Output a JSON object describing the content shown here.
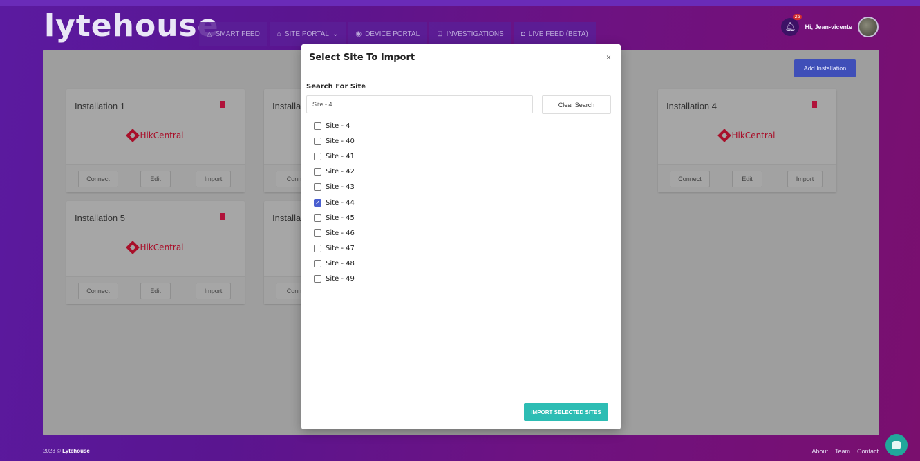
{
  "app": {
    "logo_text": "lytehouse"
  },
  "nav": [
    {
      "label": "SMART FEED",
      "icon": "bell-outline-icon"
    },
    {
      "label": "SITE PORTAL",
      "icon": "home-icon"
    },
    {
      "label": "DEVICE PORTAL",
      "icon": "device-icon"
    },
    {
      "label": "INVESTIGATIONS",
      "icon": "investigation-icon"
    },
    {
      "label": "LIVE FEED (BETA)",
      "icon": "camera-icon"
    }
  ],
  "user": {
    "notification_count": "26",
    "greeting": "Hi, Jean-vicente"
  },
  "main": {
    "add_button_label": "Add Installation",
    "cards": [
      {
        "title": "Installation 1",
        "brand": "HikCentral"
      },
      {
        "title": "Installa",
        "brand": ""
      },
      {
        "title": "Installation 4",
        "brand": "HikCentral"
      },
      {
        "title": "Installation 5",
        "brand": "HikCentral"
      },
      {
        "title": "Installa",
        "brand": ""
      }
    ],
    "card_actions": {
      "connect": "Connect",
      "edit": "Edit",
      "import": "Import",
      "connect_partial": "Conne"
    }
  },
  "modal": {
    "title": "Select Site To Import",
    "close_glyph": "×",
    "search_label": "Search For Site",
    "search_value": "Site - 4",
    "clear_label": "Clear Search",
    "sites": [
      {
        "label": "Site - 4",
        "checked": false
      },
      {
        "label": "Site - 40",
        "checked": false
      },
      {
        "label": "Site - 41",
        "checked": false
      },
      {
        "label": "Site - 42",
        "checked": false
      },
      {
        "label": "Site - 43",
        "checked": false
      },
      {
        "label": "Site - 44",
        "checked": true
      },
      {
        "label": "Site - 45",
        "checked": false
      },
      {
        "label": "Site - 46",
        "checked": false
      },
      {
        "label": "Site - 47",
        "checked": false
      },
      {
        "label": "Site - 48",
        "checked": false
      },
      {
        "label": "Site - 49",
        "checked": false
      }
    ],
    "import_label": "IMPORT SELECTED SITES"
  },
  "footer": {
    "copyright_prefix": "2023 ©",
    "copyright_brand": "Lytehouse",
    "links": [
      "About",
      "Team",
      "Contact"
    ]
  },
  "colors": {
    "accent": "#3f4fb8",
    "import_button": "#2dbdb4",
    "brand_hik": "#a8102a",
    "checkbox_checked": "#4a5fd0"
  }
}
